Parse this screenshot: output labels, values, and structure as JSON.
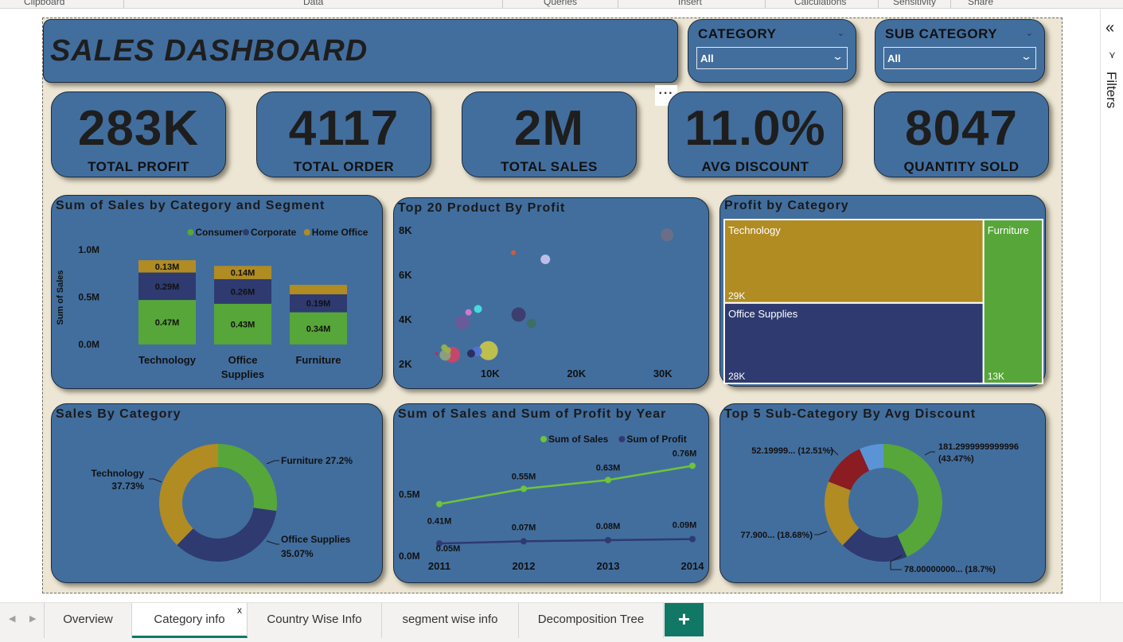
{
  "ribbon": {
    "groups": [
      "Clipboard",
      "Data",
      "Queries",
      "Insert",
      "Calculations",
      "Sensitivity",
      "Share"
    ]
  },
  "dashboard": {
    "title": "SALES DASHBOARD",
    "more_options": "···"
  },
  "slicers": [
    {
      "label": "CATEGORY",
      "value": "All"
    },
    {
      "label": "SUB CATEGORY",
      "value": "All"
    }
  ],
  "kpis": [
    {
      "value": "283K",
      "label": "TOTAL PROFIT"
    },
    {
      "value": "4117",
      "label": "TOTAL ORDER"
    },
    {
      "value": "2M",
      "label": "TOTAL SALES"
    },
    {
      "value": "11.0%",
      "label": "AVG DISCOUNT"
    },
    {
      "value": "8047",
      "label": "QUANTITY SOLD"
    }
  ],
  "colors": {
    "consumer": "#57a639",
    "corporate": "#2e3a70",
    "home_office": "#b08c23",
    "card": "#426e9e",
    "report_bg": "#ede6d4",
    "accent_tab": "#117865"
  },
  "filters_pane": {
    "label": "Filters"
  },
  "tabs": [
    {
      "label": "Overview",
      "active": false
    },
    {
      "label": "Category info",
      "active": true,
      "close": "x"
    },
    {
      "label": "Country Wise Info",
      "active": false
    },
    {
      "label": "segment wise info",
      "active": false
    },
    {
      "label": "Decomposition Tree",
      "active": false
    }
  ],
  "add_tab": "+",
  "chart_data": [
    {
      "id": "sales_by_category_segment",
      "type": "bar",
      "stacked": true,
      "title": "Sum of Sales by Category and Segment",
      "ylabel": "Sum of Sales",
      "xlabel": "",
      "ylim": [
        0,
        1000000
      ],
      "yticks": [
        "0.0M",
        "0.5M",
        "1.0M"
      ],
      "categories": [
        "Technology",
        "Office Supplies",
        "Furniture"
      ],
      "category_labels": [
        [
          "Technology"
        ],
        [
          "Office",
          "Supplies"
        ],
        [
          "Furniture"
        ]
      ],
      "legend_position": "top-right",
      "series": [
        {
          "name": "Consumer",
          "color": "#57a639",
          "values": [
            470000,
            430000,
            340000
          ],
          "labels": [
            "0.47M",
            "0.43M",
            "0.34M"
          ]
        },
        {
          "name": "Corporate",
          "color": "#2e3a70",
          "values": [
            290000,
            260000,
            190000
          ],
          "labels": [
            "0.29M",
            "0.26M",
            "0.19M"
          ]
        },
        {
          "name": "Home Office",
          "color": "#b08c23",
          "values": [
            130000,
            140000,
            100000
          ],
          "labels": [
            "0.13M",
            "0.14M",
            ""
          ]
        }
      ]
    },
    {
      "id": "top20_product_profit",
      "type": "scatter",
      "title": "Top 20 Product By Profit",
      "xticks": [
        "10K",
        "20K",
        "30K"
      ],
      "xtick_values": [
        10000,
        20000,
        30000
      ],
      "yticks": [
        "2K",
        "4K",
        "6K",
        "8K"
      ],
      "ytick_values": [
        2000,
        4000,
        6000,
        8000
      ],
      "xlim": [
        2000,
        35000
      ],
      "ylim": [
        2000,
        8000
      ],
      "points": [
        {
          "x": 30500,
          "y": 7780,
          "r": 8,
          "color": "#6e6e86"
        },
        {
          "x": 16400,
          "y": 6680,
          "r": 6,
          "color": "#c2c2ea"
        },
        {
          "x": 12700,
          "y": 6980,
          "r": 3,
          "color": "#d95c2e"
        },
        {
          "x": 13300,
          "y": 4200,
          "r": 9,
          "color": "#3c3c6a"
        },
        {
          "x": 8600,
          "y": 4450,
          "r": 5,
          "color": "#46e0e0"
        },
        {
          "x": 7500,
          "y": 4300,
          "r": 4,
          "color": "#d77ad0"
        },
        {
          "x": 6800,
          "y": 3850,
          "r": 9,
          "color": "#6c5a9a"
        },
        {
          "x": 14800,
          "y": 3800,
          "r": 6,
          "color": "#3e6e66"
        },
        {
          "x": 9800,
          "y": 2580,
          "r": 12,
          "color": "#c4c34a"
        },
        {
          "x": 8500,
          "y": 2550,
          "r": 6,
          "color": "#4e74d8"
        },
        {
          "x": 7800,
          "y": 2450,
          "r": 5,
          "color": "#2a2a5e"
        },
        {
          "x": 5600,
          "y": 2400,
          "r": 10,
          "color": "#cc4466"
        },
        {
          "x": 4800,
          "y": 2380,
          "r": 7,
          "color": "#8aa27e"
        },
        {
          "x": 4700,
          "y": 2720,
          "r": 4,
          "color": "#9ab24a"
        },
        {
          "x": 5100,
          "y": 2600,
          "r": 4,
          "color": "#9ab24a"
        },
        {
          "x": 3800,
          "y": 2450,
          "r": 2,
          "color": "#b03060"
        }
      ]
    },
    {
      "id": "profit_by_category",
      "type": "treemap",
      "title": "Profit by Category",
      "items": [
        {
          "name": "Technology",
          "value": 29000,
          "label": "29K",
          "color": "#b08c23"
        },
        {
          "name": "Office Supplies",
          "value": 28000,
          "label": "28K",
          "color": "#2e3a70"
        },
        {
          "name": "Furniture",
          "value": 13000,
          "label": "13K",
          "color": "#57a639"
        }
      ]
    },
    {
      "id": "sales_by_category",
      "type": "pie",
      "donut": true,
      "title": "Sales By Category",
      "slices": [
        {
          "name": "Furniture",
          "value": 27.2,
          "label": "Furniture 27.2%",
          "color": "#57a639"
        },
        {
          "name": "Office Supplies",
          "value": 35.07,
          "label": "Office Supplies\n35.07%",
          "color": "#2e3a70"
        },
        {
          "name": "Technology",
          "value": 37.73,
          "label": "Technology\n37.73%",
          "color": "#b08c23"
        }
      ]
    },
    {
      "id": "sales_profit_by_year",
      "type": "line",
      "title": "Sum of Sales and Sum of Profit by Year",
      "x": [
        "2011",
        "2012",
        "2013",
        "2014"
      ],
      "yticks": [
        "0.0M",
        "0.5M"
      ],
      "ylim": [
        0,
        800000
      ],
      "legend_position": "top-right",
      "series": [
        {
          "name": "Sum of Sales",
          "color": "#6ec43a",
          "values": [
            410000,
            550000,
            630000,
            760000
          ],
          "labels": [
            "0.41M",
            "0.55M",
            "0.63M",
            "0.76M"
          ]
        },
        {
          "name": "Sum of Profit",
          "color": "#2e3a70",
          "values": [
            50000,
            70000,
            80000,
            90000
          ],
          "labels": [
            "0.05M",
            "0.07M",
            "0.08M",
            "0.09M"
          ]
        }
      ]
    },
    {
      "id": "top5_subcategory_avg_discount",
      "type": "pie",
      "donut": true,
      "title": "Top 5 Sub-Category By Avg Discount",
      "slices": [
        {
          "name": "s1",
          "value": 43.47,
          "label": "181.2999999999996\n(43.47%)",
          "color": "#57a639"
        },
        {
          "name": "s2",
          "value": 18.7,
          "label": "78.00000000... (18.7%)",
          "color": "#2e3a70"
        },
        {
          "name": "s3",
          "value": 18.68,
          "label": "77.900... (18.68%)",
          "color": "#b08c23"
        },
        {
          "name": "s4",
          "value": 12.51,
          "label": "52.19999... (12.51%)",
          "color": "#8a1c22"
        },
        {
          "name": "s5",
          "value": 6.64,
          "label": "",
          "color": "#5b94d6"
        }
      ]
    }
  ]
}
